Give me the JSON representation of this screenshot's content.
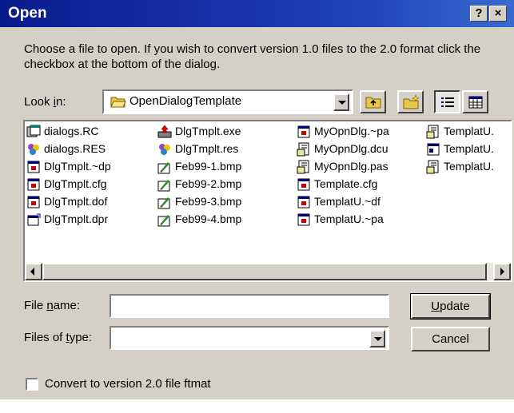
{
  "window": {
    "title": "Open",
    "help_label": "?",
    "close_label": "×"
  },
  "intro_text": "Choose a file to open. If you wish to convert version 1.0 files to the 2.0 format click the checkbox at the bottom of the dialog.",
  "look_in": {
    "label_pre": "Look ",
    "label_access": "i",
    "label_post": "n:",
    "value": "OpenDialogTemplate"
  },
  "files": [
    {
      "name": "dialogs.RC",
      "icon": "resource-script-icon"
    },
    {
      "name": "dialogs.RES",
      "icon": "resource-icon"
    },
    {
      "name": "DlgTmplt.~dp",
      "icon": "generic-file-icon"
    },
    {
      "name": "DlgTmplt.cfg",
      "icon": "generic-file-icon"
    },
    {
      "name": "DlgTmplt.dof",
      "icon": "generic-file-icon"
    },
    {
      "name": "DlgTmplt.dpr",
      "icon": "project-file-icon"
    },
    {
      "name": "DlgTmplt.exe",
      "icon": "exe-icon"
    },
    {
      "name": "DlgTmplt.res",
      "icon": "resource-icon"
    },
    {
      "name": "Feb99-1.bmp",
      "icon": "bitmap-icon"
    },
    {
      "name": "Feb99-2.bmp",
      "icon": "bitmap-icon"
    },
    {
      "name": "Feb99-3.bmp",
      "icon": "bitmap-icon"
    },
    {
      "name": "Feb99-4.bmp",
      "icon": "bitmap-icon"
    },
    {
      "name": "MyOpnDlg.~pa",
      "icon": "generic-file-icon"
    },
    {
      "name": "MyOpnDlg.dcu",
      "icon": "unit-file-icon"
    },
    {
      "name": "MyOpnDlg.pas",
      "icon": "unit-file-icon"
    },
    {
      "name": "Template.cfg",
      "icon": "generic-file-icon"
    },
    {
      "name": "TemplatU.~df",
      "icon": "generic-file-icon"
    },
    {
      "name": "TemplatU.~pa",
      "icon": "generic-file-icon"
    },
    {
      "name": "TemplatU.",
      "icon": "unit-file-icon"
    },
    {
      "name": "TemplatU.",
      "icon": "form-file-icon"
    },
    {
      "name": "TemplatU.",
      "icon": "unit-file-icon"
    }
  ],
  "file_name": {
    "label_pre": "File ",
    "label_access": "n",
    "label_post": "ame:",
    "value": ""
  },
  "file_type": {
    "label_pre": "Files of ",
    "label_access": "t",
    "label_post": "ype:",
    "value": ""
  },
  "buttons": {
    "update_access": "U",
    "update_rest": "pdate",
    "cancel": "Cancel"
  },
  "convert_checkbox": {
    "label": "Convert to version 2.0 file ftmat",
    "checked": false
  },
  "colors": {
    "title_bar": "#0a1a8c",
    "face": "#d4d0c8"
  }
}
